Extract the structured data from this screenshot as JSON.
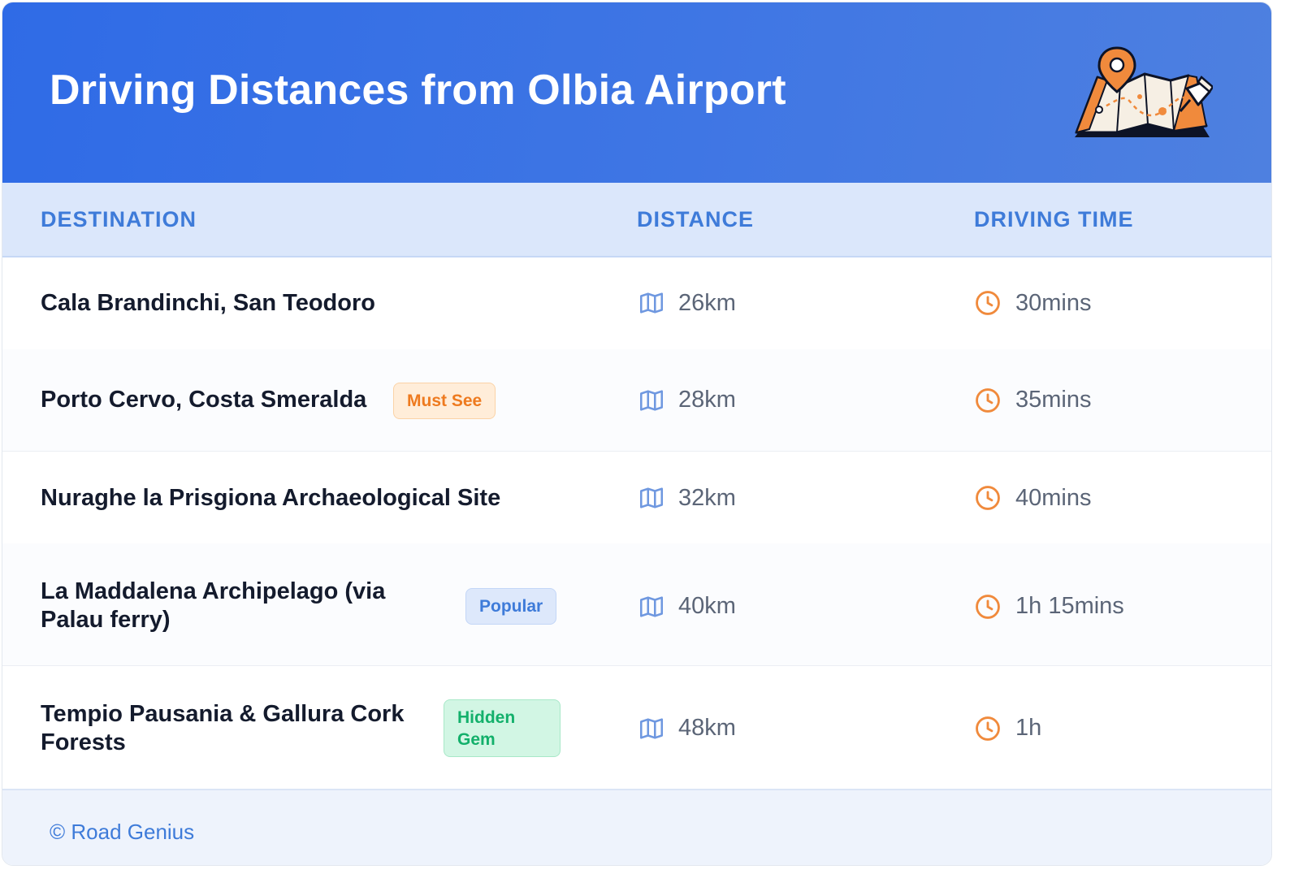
{
  "header": {
    "title": "Driving Distances from Olbia Airport",
    "illustration_icon": "map-with-pins-icon"
  },
  "table": {
    "columns": [
      "DESTINATION",
      "DISTANCE",
      "DRIVING TIME"
    ],
    "rows": [
      {
        "destination": "Cala Brandinchi, San Teodoro",
        "badge": "",
        "distance": "26km",
        "time": "30mins"
      },
      {
        "destination": "Porto Cervo, Costa Smeralda",
        "badge": "Must See",
        "distance": "28km",
        "time": "35mins"
      },
      {
        "destination": "Nuraghe la Prisgiona Archaeological Site",
        "badge": "",
        "distance": "32km",
        "time": "40mins"
      },
      {
        "destination": "La Maddalena Archipelago (via Palau ferry)",
        "badge": "Popular",
        "distance": "40km",
        "time": "1h 15mins"
      },
      {
        "destination": "Tempio Pausania & Gallura Cork Forests",
        "badge": "Hidden Gem",
        "distance": "48km",
        "time": "1h"
      }
    ],
    "distance_icon": "map-icon",
    "time_icon": "clock-icon"
  },
  "footer": {
    "credit": "© Road Genius"
  },
  "colors": {
    "header_gradient_start": "#2f6be6",
    "header_gradient_end": "#4e80e0",
    "column_header_text": "#3e7bd9",
    "clock_icon": "#f08a3c",
    "map_icon": "#6f98e0",
    "badge_must_see": "#ee7a1f",
    "badge_popular": "#3e7bd9",
    "badge_hidden_gem": "#13b06b"
  }
}
